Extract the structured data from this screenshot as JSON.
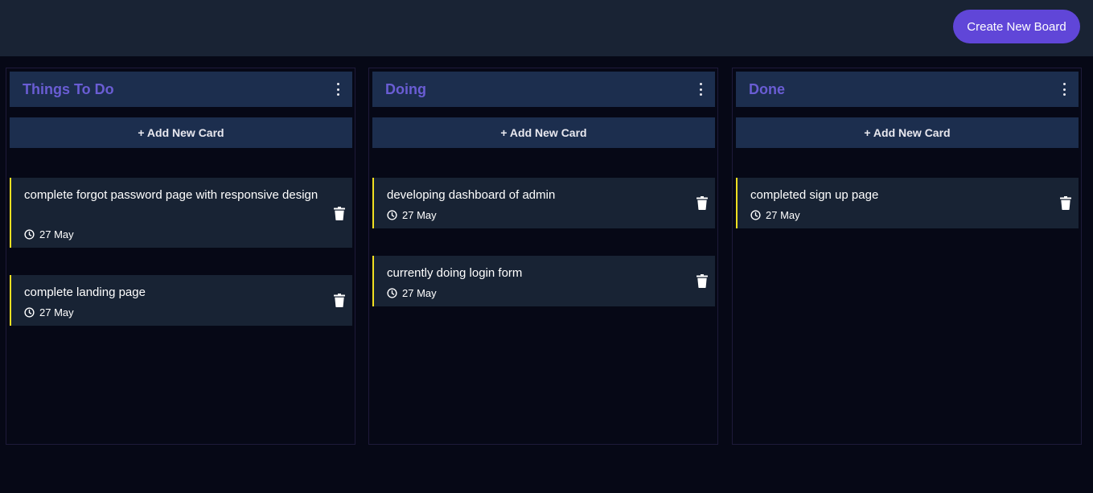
{
  "header": {
    "create_board_label": "Create New Board"
  },
  "colors": {
    "accent": "#6046d8",
    "column_header_bg": "#1c2e4e",
    "column_title": "#6a5dd4",
    "card_bg": "#182334",
    "card_marker": "#f1e021",
    "page_bg": "#060816",
    "topbar_bg": "#192334"
  },
  "icons": {
    "menu": "kebab-menu-icon",
    "date": "clock-icon",
    "delete": "trash-icon"
  },
  "boards": [
    {
      "title": "Things To Do",
      "add_card_label": "+ Add New Card",
      "cards": [
        {
          "title": "complete forgot password page with responsive design",
          "date": "27 May"
        },
        {
          "title": "complete landing page",
          "date": "27 May"
        }
      ]
    },
    {
      "title": "Doing",
      "add_card_label": "+ Add New Card",
      "cards": [
        {
          "title": "developing dashboard of admin",
          "date": "27 May"
        },
        {
          "title": "currently doing login form",
          "date": "27 May"
        }
      ]
    },
    {
      "title": "Done",
      "add_card_label": "+ Add New Card",
      "cards": [
        {
          "title": "completed sign up page",
          "date": "27 May"
        }
      ]
    }
  ]
}
